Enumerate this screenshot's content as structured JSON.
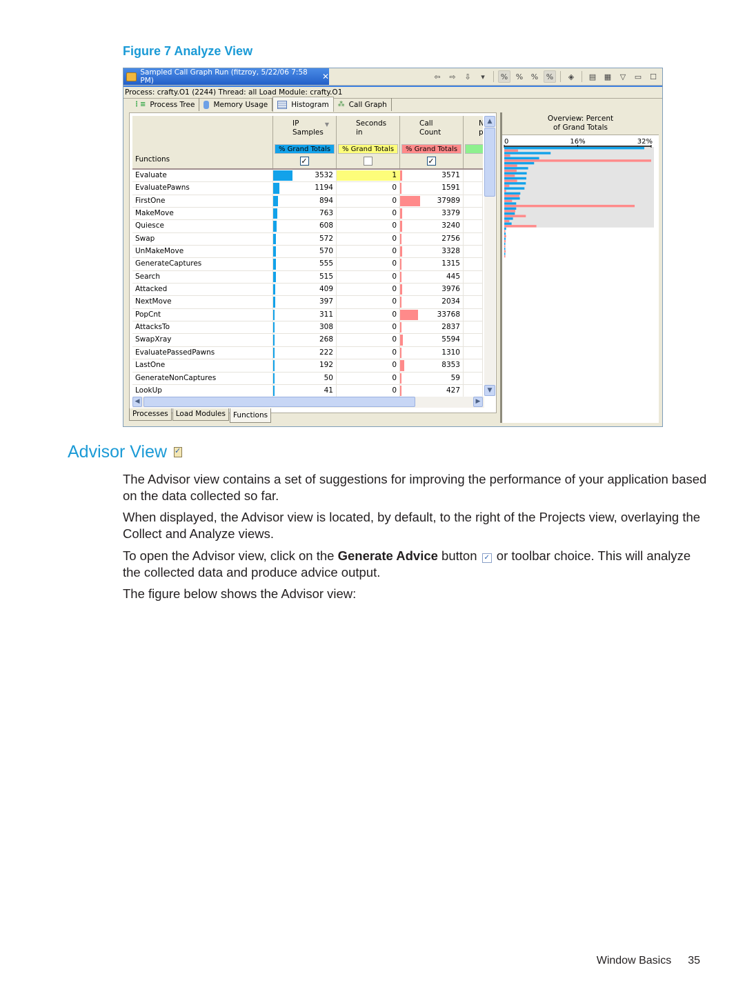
{
  "figure_caption": "Figure 7 Analyze View",
  "window": {
    "editor_tab": {
      "title": "Sampled Call Graph Run (fitzroy, 5/22/06 7:58 PM)",
      "close_label": "✕"
    },
    "toolbar": [
      {
        "name": "back-arrow-icon",
        "glyph": "⇦"
      },
      {
        "name": "forward-arrow-icon",
        "glyph": "⇨"
      },
      {
        "name": "down-arrow-icon",
        "glyph": "⇩"
      },
      {
        "name": "dropdown-icon",
        "glyph": "▾"
      },
      {
        "name": "percent-blue-icon",
        "glyph": "%",
        "pressed": true
      },
      {
        "name": "percent-star-icon",
        "glyph": "%"
      },
      {
        "name": "percent-icon",
        "glyph": "%"
      },
      {
        "name": "percent-lock-icon",
        "glyph": "%",
        "pressed": true
      },
      {
        "name": "diamond-tool-icon",
        "glyph": "◈"
      },
      {
        "name": "columns-icon",
        "glyph": "▤"
      },
      {
        "name": "color-grid-icon",
        "glyph": "▦"
      },
      {
        "name": "view-menu-icon",
        "glyph": "▽"
      },
      {
        "name": "minimize-icon",
        "glyph": "▭"
      },
      {
        "name": "maximize-icon",
        "glyph": "☐"
      }
    ],
    "info_bar": "Process: crafty.O1 (2244)   Thread: all   Load Module: crafty.O1",
    "view_tabs": [
      {
        "label": "Process Tree",
        "icon": "process-tree-icon",
        "active": false
      },
      {
        "label": "Memory Usage",
        "icon": "memory-icon",
        "active": false
      },
      {
        "label": "Histogram",
        "icon": "histogram-icon",
        "active": true
      },
      {
        "label": "Call Graph",
        "icon": "call-graph-icon",
        "active": false
      }
    ],
    "table": {
      "function_header": "Functions",
      "columns": [
        {
          "title": "IP\nSamples",
          "sorted": true,
          "grand_totals_label": "% Grand Totals",
          "color": "#12a2ea",
          "checked": true
        },
        {
          "title": "Seconds\nin",
          "sorted": false,
          "grand_totals_label": "% Grand Totals",
          "color": "#fdfd7a",
          "checked": false
        },
        {
          "title": "Call\nCount",
          "sorted": false,
          "grand_totals_label": "% Grand Totals",
          "color": "#ff8a8a",
          "checked": true
        },
        {
          "title": "N\np",
          "sorted": false,
          "grand_totals_label": "",
          "color": "#8ef08e",
          "checked": null
        }
      ],
      "rows": [
        {
          "name": "Evaluate",
          "ip_samples": 3532,
          "seconds": 1,
          "call_count": 3571
        },
        {
          "name": "EvaluatePawns",
          "ip_samples": 1194,
          "seconds": 0,
          "call_count": 1591
        },
        {
          "name": "FirstOne",
          "ip_samples": 894,
          "seconds": 0,
          "call_count": 37989
        },
        {
          "name": "MakeMove",
          "ip_samples": 763,
          "seconds": 0,
          "call_count": 3379
        },
        {
          "name": "Quiesce",
          "ip_samples": 608,
          "seconds": 0,
          "call_count": 3240
        },
        {
          "name": "Swap",
          "ip_samples": 572,
          "seconds": 0,
          "call_count": 2756
        },
        {
          "name": "UnMakeMove",
          "ip_samples": 570,
          "seconds": 0,
          "call_count": 3328
        },
        {
          "name": "GenerateCaptures",
          "ip_samples": 555,
          "seconds": 0,
          "call_count": 1315
        },
        {
          "name": "Search",
          "ip_samples": 515,
          "seconds": 0,
          "call_count": 445
        },
        {
          "name": "Attacked",
          "ip_samples": 409,
          "seconds": 0,
          "call_count": 3976
        },
        {
          "name": "NextMove",
          "ip_samples": 397,
          "seconds": 0,
          "call_count": 2034
        },
        {
          "name": "PopCnt",
          "ip_samples": 311,
          "seconds": 0,
          "call_count": 33768
        },
        {
          "name": "AttacksTo",
          "ip_samples": 308,
          "seconds": 0,
          "call_count": 2837
        },
        {
          "name": "SwapXray",
          "ip_samples": 268,
          "seconds": 0,
          "call_count": 5594
        },
        {
          "name": "EvaluatePassedPawns",
          "ip_samples": 222,
          "seconds": 0,
          "call_count": 1310
        },
        {
          "name": "LastOne",
          "ip_samples": 192,
          "seconds": 0,
          "call_count": 8353
        },
        {
          "name": "GenerateNonCaptures",
          "ip_samples": 50,
          "seconds": 0,
          "call_count": 59
        },
        {
          "name": "LookUp",
          "ip_samples": 41,
          "seconds": 0,
          "call_count": 427
        }
      ],
      "bar_max": {
        "ip_samples": 3532,
        "seconds": 1,
        "call_count": 37989
      }
    },
    "bottom_tabs": [
      {
        "label": "Processes",
        "active": false
      },
      {
        "label": "Load Modules",
        "active": false
      },
      {
        "label": "Functions",
        "active": true
      }
    ],
    "overview": {
      "title_line1": "Overview: Percent",
      "title_line2": "of Grand Totals"
    }
  },
  "chart_data": {
    "type": "bar",
    "title": "Overview: Percent of Grand Totals",
    "orientation": "horizontal",
    "xlim": [
      0,
      32
    ],
    "x_ticks": [
      "0",
      "16%",
      "32%"
    ],
    "series": [
      {
        "name": "IP Samples % Grand Totals",
        "color": "#12a2ea",
        "values": [
          30.5,
          10.1,
          7.6,
          6.5,
          5.2,
          4.9,
          4.8,
          4.7,
          4.4,
          3.5,
          3.4,
          2.6,
          2.6,
          2.3,
          1.9,
          1.6,
          0.4,
          0.3,
          0.3,
          0.2,
          0.2,
          0.1
        ]
      },
      {
        "name": "Call Count % Grand Totals",
        "color": "#ff8a8a",
        "values": [
          3.0,
          1.3,
          32.0,
          2.8,
          2.7,
          2.3,
          2.8,
          1.1,
          0.4,
          3.3,
          1.7,
          28.4,
          2.4,
          4.7,
          1.1,
          7.0,
          0.1,
          0.4,
          0.3,
          0.2,
          0.3,
          0.2
        ]
      }
    ],
    "grid": false,
    "legend": "none"
  },
  "section": {
    "heading": "Advisor View",
    "heading_icon": "advisor-icon",
    "paragraphs": [
      "The Advisor view contains a set of suggestions for improving the performance of your application based on the data collected so far.",
      "When displayed, the Advisor view is located, by default, to the right of the Projects view, overlaying the Collect and Analyze views."
    ],
    "open_para": {
      "before": "To open the Advisor view, click on the ",
      "bold": "Generate Advice",
      "middle": " button ",
      "after": " or toolbar choice. This will analyze the collected data and produce advice output."
    },
    "last_para": "The figure below shows the Advisor view:"
  },
  "footer": {
    "section": "Window Basics",
    "page": "35"
  }
}
